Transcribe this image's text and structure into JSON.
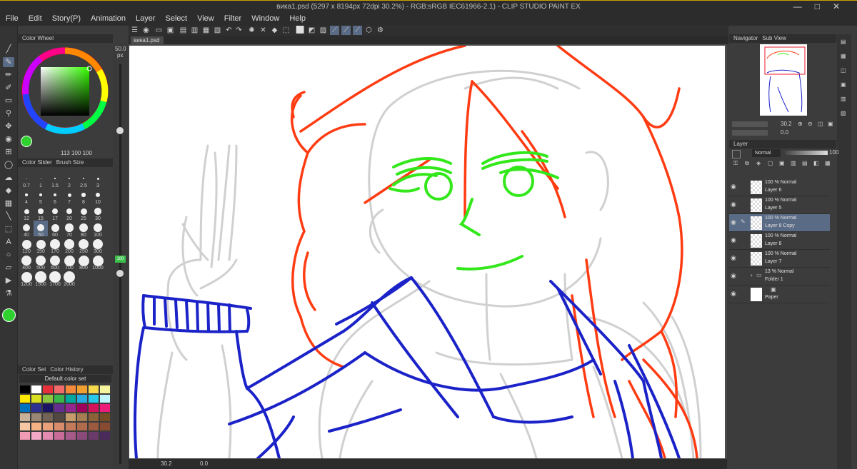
{
  "window": {
    "title": "вика1.psd (5297 x 8194px 72dpi 30.2%) - RGB:sRGB IEC61966-2.1) - CLIP STUDIO PAINT EX",
    "buttons": [
      "—",
      "□",
      "✕"
    ]
  },
  "menu": [
    "File",
    "Edit",
    "Story(P)",
    "Animation",
    "Layer",
    "Select",
    "View",
    "Filter",
    "Window",
    "Help"
  ],
  "left": {
    "color_wheel_tab": "Color Wheel",
    "color_values": [
      "113",
      "100",
      "100"
    ],
    "brush_tabs": [
      "Color Slider",
      "Brush Size"
    ],
    "brush_sizes": [
      "0.7",
      "1",
      "1.5",
      "2",
      "2.5",
      "3",
      "4",
      "5",
      "6",
      "7",
      "8",
      "10",
      "12",
      "15",
      "17",
      "20",
      "25",
      "30",
      "40",
      "50",
      "60",
      "70",
      "80",
      "100",
      "120",
      "150",
      "170",
      "200",
      "250",
      "300",
      "400",
      "500",
      "600",
      "700",
      "800",
      "1000",
      "1200",
      "1500",
      "1700",
      "2000"
    ],
    "selected_brush": "50",
    "color_set_tabs": [
      "Color Set",
      "Color History"
    ],
    "color_set_name": "Default color set",
    "size_value": "50.0",
    "size_unit": "px",
    "opacity_value": "100"
  },
  "document": {
    "tab": "вика1.psd"
  },
  "status": {
    "zoom": "30.2",
    "angle": "0.0"
  },
  "right": {
    "navigator_tabs": [
      "Navigator",
      "Sub View"
    ],
    "zoom": "30.2",
    "rotate": "0.0",
    "layer_tab": "Layer",
    "blend_mode": "Normal",
    "opacity": "100"
  },
  "layers": [
    {
      "mode": "100 % Normal",
      "name": "Layer 6",
      "selected": false
    },
    {
      "mode": "100 % Normal",
      "name": "Layer 5",
      "selected": false
    },
    {
      "mode": "100 % Normal",
      "name": "Layer 8 Copy",
      "selected": true
    },
    {
      "mode": "100 % Normal",
      "name": "Layer 8",
      "selected": false
    },
    {
      "mode": "100 % Normal",
      "name": "Layer 7",
      "selected": false
    },
    {
      "mode": "13 % Normal",
      "name": "Folder 1",
      "selected": false
    },
    {
      "mode": "",
      "name": "Paper",
      "selected": false
    }
  ],
  "colors": {
    "main": "#2fd12f",
    "hair_lines": "#ff3b12",
    "face_lines": "#33e81a",
    "body_lines": "#1a22c8",
    "sketch_lines": "#d0d0d0",
    "swatches": [
      "#000000",
      "#ffffff",
      "#e8303a",
      "#f26b6b",
      "#f48a3a",
      "#f0a030",
      "#f7d94c",
      "#f5f5a0",
      "#ffe800",
      "#d9e021",
      "#8cc63f",
      "#39b54a",
      "#00a99d",
      "#29abe2",
      "#27c8e8",
      "#bff5ff",
      "#0071bc",
      "#2e3192",
      "#1b1464",
      "#662d91",
      "#93278f",
      "#9e005d",
      "#d4145a",
      "#ed1e79",
      "#c7b299",
      "#998675",
      "#736357",
      "#534741",
      "#c69c6d",
      "#a67c52",
      "#8c6239",
      "#754c24",
      "#f7c6a5",
      "#f4b183",
      "#e8a07a",
      "#d88c6c",
      "#c47a5a",
      "#b06a4c",
      "#9c5a3e",
      "#884a30",
      "#f29bb5",
      "#f4a8c8",
      "#e38bb0",
      "#c86b98",
      "#a65a8a",
      "#8a4a7a",
      "#6a3a6a",
      "#4a2a5a"
    ]
  }
}
